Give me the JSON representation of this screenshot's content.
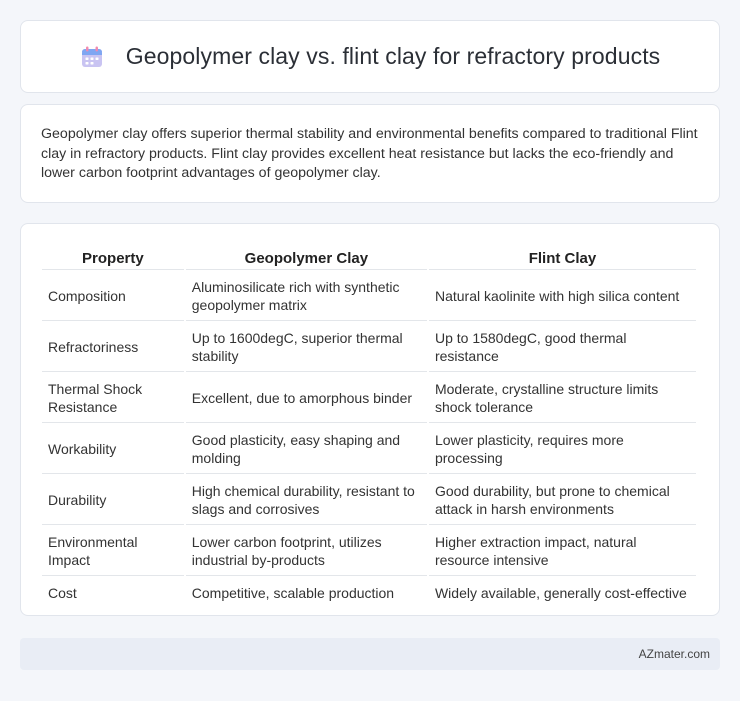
{
  "header": {
    "title": "Geopolymer clay vs. flint clay for refractory products",
    "icon": "calendar-icon"
  },
  "intro": {
    "text": "Geopolymer clay offers superior thermal stability and environmental benefits compared to traditional Flint clay in refractory products. Flint clay provides excellent heat resistance but lacks the eco-friendly and lower carbon footprint advantages of geopolymer clay."
  },
  "table": {
    "headers": [
      "Property",
      "Geopolymer Clay",
      "Flint Clay"
    ],
    "rows": [
      [
        "Composition",
        "Aluminosilicate rich with synthetic geopolymer matrix",
        "Natural kaolinite with high silica content"
      ],
      [
        "Refractoriness",
        "Up to 1600degC, superior thermal stability",
        "Up to 1580degC, good thermal resistance"
      ],
      [
        "Thermal Shock Resistance",
        "Excellent, due to amorphous binder",
        "Moderate, crystalline structure limits shock tolerance"
      ],
      [
        "Workability",
        "Good plasticity, easy shaping and molding",
        "Lower plasticity, requires more processing"
      ],
      [
        "Durability",
        "High chemical durability, resistant to slags and corrosives",
        "Good durability, but prone to chemical attack in harsh environments"
      ],
      [
        "Environmental Impact",
        "Lower carbon footprint, utilizes industrial by-products",
        "Higher extraction impact, natural resource intensive"
      ],
      [
        "Cost",
        "Competitive, scalable production",
        "Widely available, generally cost-effective"
      ]
    ]
  },
  "footer": {
    "brand": "AZmater.com"
  }
}
